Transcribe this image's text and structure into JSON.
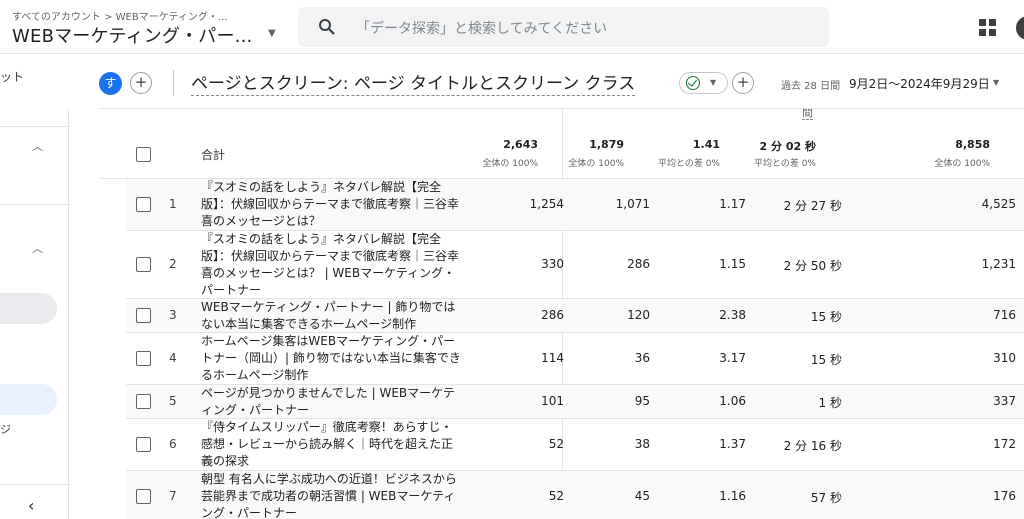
{
  "header": {
    "breadcrumb": "すべてのアカウント > WEBマーケティング・...",
    "property_name": "WEBマーケティング・パー...",
    "search_placeholder": "「データ探索」と検索してみてください"
  },
  "sidebar": {
    "item_top": "ット",
    "item_lower": "ジ"
  },
  "toolbar": {
    "comparison_avatar": "す",
    "add_label": "+",
    "report_title": "ページとスクリーン: ページ タイトルとスクリーン クラス",
    "date_label": "過去 28 日間",
    "date_range": "9月2日～2024年9月29日"
  },
  "table": {
    "partial_header": "間",
    "totals": {
      "label": "合計",
      "values": [
        "2,643",
        "1,879",
        "1.41",
        "2 分 02 秒",
        "8,858"
      ],
      "subs": [
        "全体の 100%",
        "全体の 100%",
        "平均との差 0%",
        "平均との差 0%",
        "全体の 100%"
      ]
    },
    "rows": [
      {
        "rank": "1",
        "title": "『スオミの話をしよう』ネタバレ解説【完全版】：伏線回収からテーマまで徹底考察｜三谷幸喜のメッセージとは？",
        "values": [
          "1,254",
          "1,071",
          "1.17",
          "2 分 27 秒",
          "4,525"
        ]
      },
      {
        "rank": "2",
        "title": "『スオミの話をしよう』ネタバレ解説【完全版】：伏線回収からテーマまで徹底考察｜三谷幸喜のメッセージとは？ | WEBマーケティング・パートナー",
        "values": [
          "330",
          "286",
          "1.15",
          "2 分 50 秒",
          "1,231"
        ]
      },
      {
        "rank": "3",
        "title": "WEBマーケティング・パートナー | 飾り物ではない本当に集客できるホームページ制作",
        "values": [
          "286",
          "120",
          "2.38",
          "15 秒",
          "716"
        ]
      },
      {
        "rank": "4",
        "title": "ホームページ集客はWEBマーケティング・パートナー（岡山）| 飾り物ではない本当に集客できるホームページ制作",
        "values": [
          "114",
          "36",
          "3.17",
          "15 秒",
          "310"
        ]
      },
      {
        "rank": "5",
        "title": "ページが見つかりませんでした | WEBマーケティング・パートナー",
        "values": [
          "101",
          "95",
          "1.06",
          "1 秒",
          "337"
        ]
      },
      {
        "rank": "6",
        "title": "『侍タイムスリッパー』徹底考察！あらすじ・感想・レビューから読み解く｜時代を超えた正義の探求",
        "values": [
          "52",
          "38",
          "1.37",
          "2 分 16 秒",
          "172"
        ]
      },
      {
        "rank": "7",
        "title": "朝型 有名人に学ぶ成功への近道！ビジネスから芸能界まで成功者の朝活習慣 | WEBマーケティング・パートナー",
        "values": [
          "52",
          "45",
          "1.16",
          "57 秒",
          "176"
        ]
      }
    ]
  },
  "icons": [
    "search-icon",
    "apps-grid-icon",
    "chevron-up-icon",
    "chevron-left-icon",
    "check-circle-icon",
    "caret-down-icon",
    "plus-icon"
  ],
  "colors": {
    "accent": "#1a73e8",
    "status_ok": "#137333",
    "alt_row": "#f8f9fa"
  }
}
